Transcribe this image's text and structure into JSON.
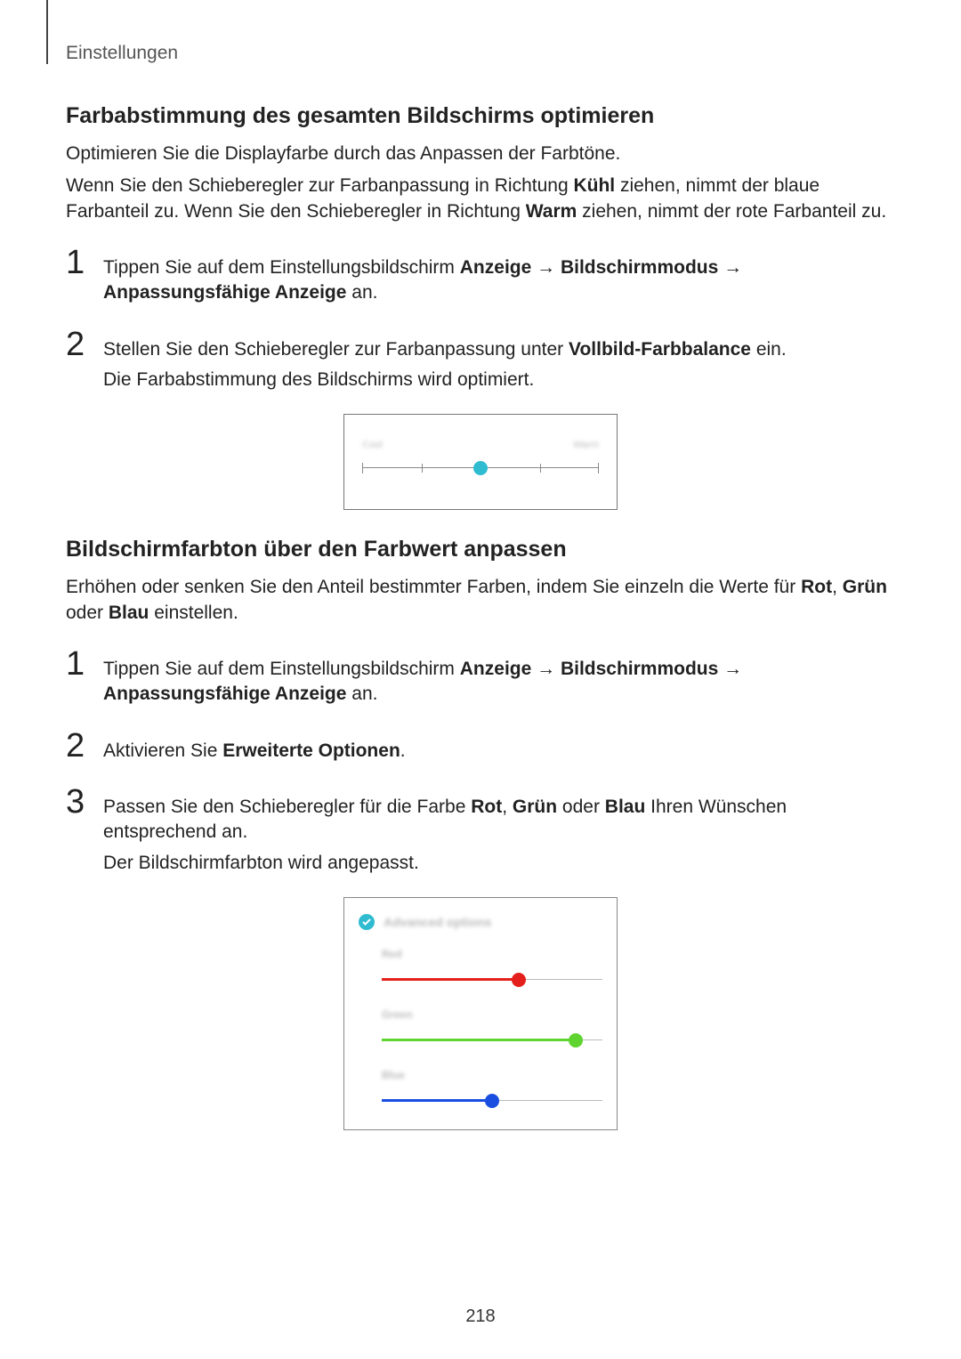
{
  "breadcrumb": "Einstellungen",
  "page_number": "218",
  "section1": {
    "heading": "Farbabstimmung des gesamten Bildschirms optimieren",
    "intro": "Optimieren Sie die Displayfarbe durch das Anpassen der Farbtöne.",
    "explain_prefix": "Wenn Sie den Schieberegler zur Farbanpassung in Richtung ",
    "cool_label": "Kühl",
    "explain_mid": " ziehen, nimmt der blaue Farbanteil zu. Wenn Sie den Schieberegler in Richtung ",
    "warm_label": "Warm",
    "explain_suffix": " ziehen, nimmt der rote Farbanteil zu.",
    "step1": {
      "num": "1",
      "pre": "Tippen Sie auf dem Einstellungsbildschirm ",
      "b1": "Anzeige",
      "arrow1": " → ",
      "b2": "Bildschirmmodus",
      "arrow2": " → ",
      "b3": "Anpassungsfähige Anzeige",
      "post": " an."
    },
    "step2": {
      "num": "2",
      "pre": "Stellen Sie den Schieberegler zur Farbanpassung unter ",
      "b": "Vollbild-Farbbalance",
      "post": " ein.",
      "result": "Die Farbabstimmung des Bildschirms wird optimiert."
    },
    "fig": {
      "left_label": "Cool",
      "right_label": "Warm",
      "thumb_percent": 50
    }
  },
  "section2": {
    "heading": "Bildschirmfarbton über den Farbwert anpassen",
    "intro_pre": "Erhöhen oder senken Sie den Anteil bestimmter Farben, indem Sie einzeln die Werte für ",
    "b_rot": "Rot",
    "comma": ", ",
    "b_gruen": "Grün",
    "or": " oder ",
    "b_blau": "Blau",
    "intro_post": " einstellen.",
    "step1": {
      "num": "1",
      "pre": "Tippen Sie auf dem Einstellungsbildschirm ",
      "b1": "Anzeige",
      "arrow1": " → ",
      "b2": "Bildschirmmodus",
      "arrow2": " → ",
      "b3": "Anpassungsfähige Anzeige",
      "post": " an."
    },
    "step2": {
      "num": "2",
      "pre": "Aktivieren Sie ",
      "b": "Erweiterte Optionen",
      "post": "."
    },
    "step3": {
      "num": "3",
      "pre": "Passen Sie den Schieberegler für die Farbe ",
      "b_rot": "Rot",
      "comma": ", ",
      "b_gruen": "Grün",
      "or": " oder ",
      "b_blau": "Blau",
      "post": " Ihren Wünschen entsprechend an.",
      "result": "Der Bildschirmfarbton wird angepasst."
    },
    "fig": {
      "header_label": "Advanced options",
      "red": {
        "label": "Red",
        "color": "#e4201c",
        "percent": 62
      },
      "green": {
        "label": "Green",
        "color": "#5fd430",
        "percent": 88
      },
      "blue": {
        "label": "Blue",
        "color": "#1a4ee0",
        "percent": 50
      }
    }
  }
}
